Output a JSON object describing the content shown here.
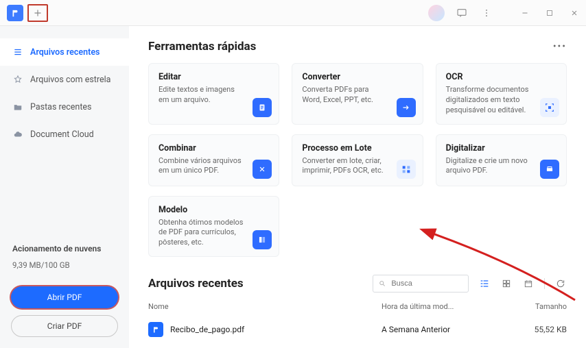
{
  "sidebar": {
    "items": [
      {
        "label": "Arquivos recentes"
      },
      {
        "label": "Arquivos com estrela"
      },
      {
        "label": "Pastas recentes"
      },
      {
        "label": "Document Cloud"
      }
    ],
    "cloud": {
      "title": "Acionamento de nuvens",
      "usage": "9,39 MB/100 GB"
    },
    "buttons": {
      "open": "Abrir PDF",
      "create": "Criar PDF"
    }
  },
  "tools": {
    "title": "Ferramentas rápidas",
    "cards": [
      {
        "title": "Editar",
        "desc": "Edite textos e imagens em um arquivo."
      },
      {
        "title": "Converter",
        "desc": "Converta PDFs para Word, Excel, PPT, etc."
      },
      {
        "title": "OCR",
        "desc": "Transforme documentos digitalizados em texto pesquisável ou editável."
      },
      {
        "title": "Combinar",
        "desc": "Combine vários arquivos em um único PDF."
      },
      {
        "title": "Processo em Lote",
        "desc": "Converter em lote, criar, imprimir, PDFs OCR, etc."
      },
      {
        "title": "Digitalizar",
        "desc": "Digitalize e crie um novo arquivo PDF."
      },
      {
        "title": "Modelo",
        "desc": "Obtenha ótimos modelos de PDF para currículos, pôsteres, etc."
      }
    ]
  },
  "recent": {
    "title": "Arquivos recentes",
    "searchPlaceholder": "Busca",
    "cols": {
      "name": "Nome",
      "mod": "Hora da última mod...",
      "size": "Tamanho"
    },
    "rows": [
      {
        "name": "Recibo_de_pago.pdf",
        "mod": "A Semana Anterior",
        "size": "55,52 KB"
      }
    ]
  }
}
